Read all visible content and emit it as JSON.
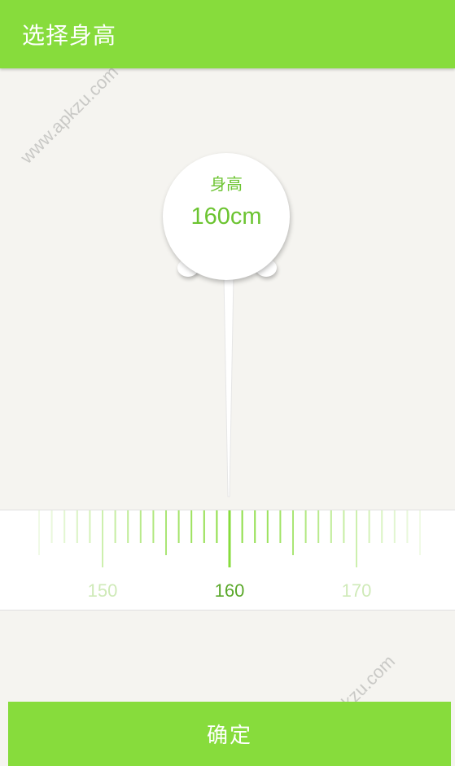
{
  "app_bar": {
    "title": "选择身高"
  },
  "indicator": {
    "label": "身高",
    "value": "160cm"
  },
  "ruler": {
    "current": 160,
    "min_visible": 145,
    "max_visible": 175,
    "major_labels": [
      "150",
      "160",
      "170"
    ],
    "accent_color": "#87dc3c"
  },
  "actions": {
    "confirm_label": "确定"
  },
  "watermark": {
    "text": "www.apkzu.com"
  }
}
